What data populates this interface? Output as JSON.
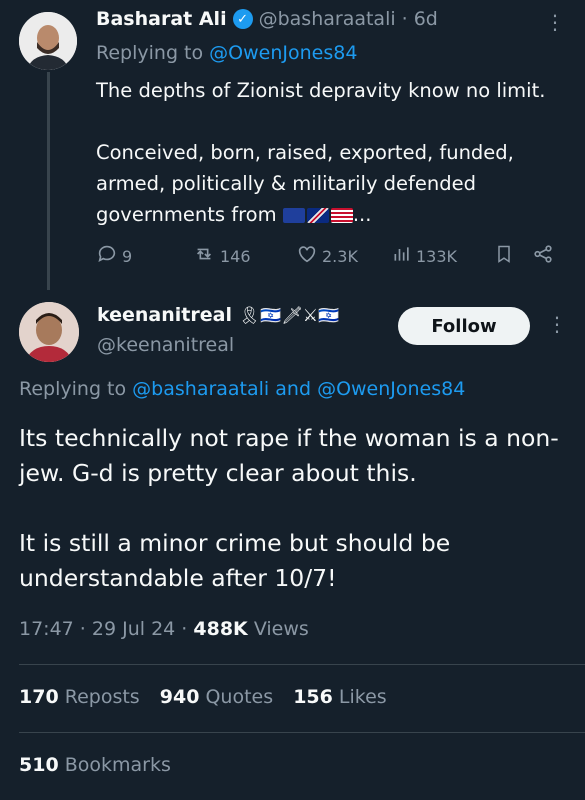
{
  "tweet1": {
    "name": "Basharat Ali",
    "handle": "@basharaatali",
    "time": "· 6d",
    "replying_prefix": "Replying to",
    "replying_to": "@OwenJones84",
    "text_line1": "The depths of Zionist depravity know no limit.",
    "text_para2": "Conceived, born, raised, exported, funded, armed, politically & militarily defended governments from",
    "text_ellipsis": "...",
    "actions": {
      "replies": "9",
      "reposts": "146",
      "likes": "2.3K",
      "views": "133K"
    },
    "icons": {
      "verified": "verified-badge-icon",
      "more": "more-icon",
      "reply": "reply-icon",
      "repost": "repost-icon",
      "like": "heart-icon",
      "views": "views-icon",
      "bookmark": "bookmark-icon",
      "share": "share-icon"
    }
  },
  "tweet2": {
    "name": "keenanitreal",
    "name_emoji": "🎗🇮🇱🗡⚔🇮🇱",
    "handle": "@keenanitreal",
    "follow_label": "Follow",
    "replying_prefix": "Replying to",
    "replying_to_1": "@basharaatali",
    "replying_and": "and",
    "replying_to_2": "@OwenJones84",
    "text_para1": "Its technically not rape if the woman is a non-jew.  G-d is pretty clear about this.",
    "text_para2": "It is still a minor crime but should be understandable after 10/7!",
    "time": "17:47",
    "date": "29 Jul 24",
    "views_count": "488K",
    "views_label": "Views",
    "reposts_count": "170",
    "reposts_label": "Reposts",
    "quotes_count": "940",
    "quotes_label": "Quotes",
    "likes_count": "156",
    "likes_label": "Likes",
    "bookmarks_count": "510",
    "bookmarks_label": "Bookmarks"
  },
  "colors": {
    "background": "#15202b",
    "text": "#f7f9f9",
    "muted": "#8b98a5",
    "link": "#1d9bf0",
    "divider": "#38444d"
  }
}
